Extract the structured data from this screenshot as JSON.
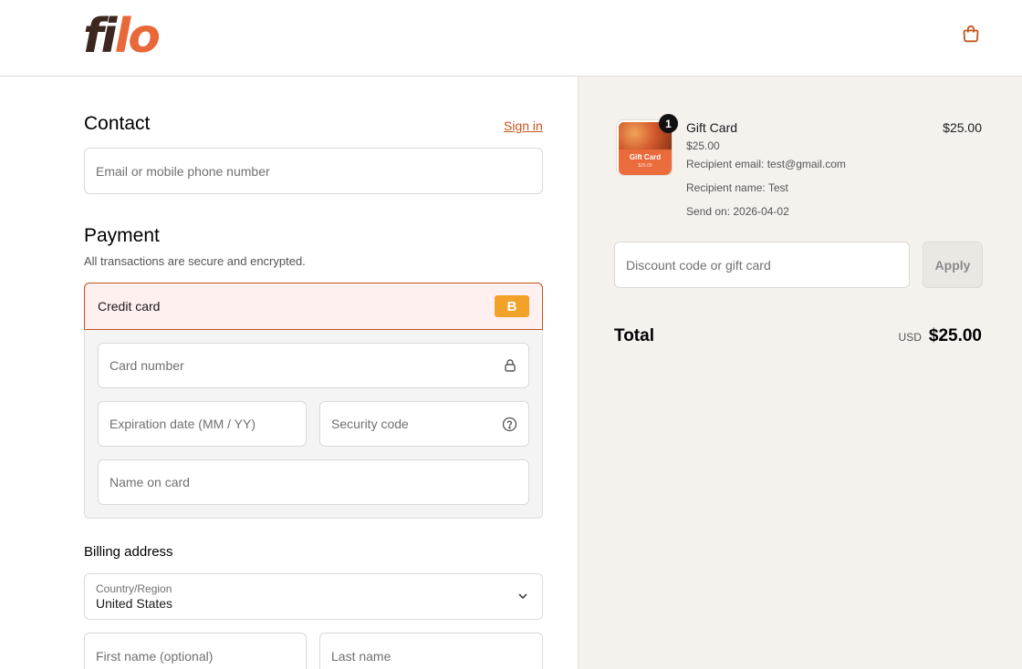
{
  "header": {
    "logo_part1": "fi",
    "logo_part2": "lo",
    "cart_icon": "shopping-bag-icon"
  },
  "contact": {
    "title": "Contact",
    "sign_in": "Sign in",
    "email_placeholder": "Email or mobile phone number"
  },
  "payment": {
    "title": "Payment",
    "subtitle": "All transactions are secure and encrypted.",
    "method_label": "Credit card",
    "method_badge": "B",
    "card_number_placeholder": "Card number",
    "expiration_placeholder": "Expiration date (MM / YY)",
    "security_code_placeholder": "Security code",
    "name_on_card_placeholder": "Name on card",
    "lock_icon": "lock-icon",
    "help_icon": "question-circle-icon"
  },
  "billing": {
    "title": "Billing address",
    "country_label": "Country/Region",
    "country_value": "United States",
    "first_name_placeholder": "First name (optional)",
    "last_name_placeholder": "Last name"
  },
  "summary": {
    "item": {
      "name": "Gift Card",
      "price": "$25.00",
      "variant": "$25.00",
      "recipient_email": "Recipient email: test@gmail.com",
      "recipient_name": "Recipient name: Test",
      "send_on": "Send on: 2026-04-02",
      "quantity": "1",
      "thumb_title": "Gift Card",
      "thumb_sub": "$25.00"
    },
    "discount_placeholder": "Discount code or gift card",
    "apply_label": "Apply",
    "total_label": "Total",
    "currency": "USD",
    "total_amount": "$25.00"
  },
  "colors": {
    "accent": "#c4551e",
    "logo_dark": "#3b2620",
    "logo_orange": "#e8683a",
    "badge": "#f2a229"
  }
}
